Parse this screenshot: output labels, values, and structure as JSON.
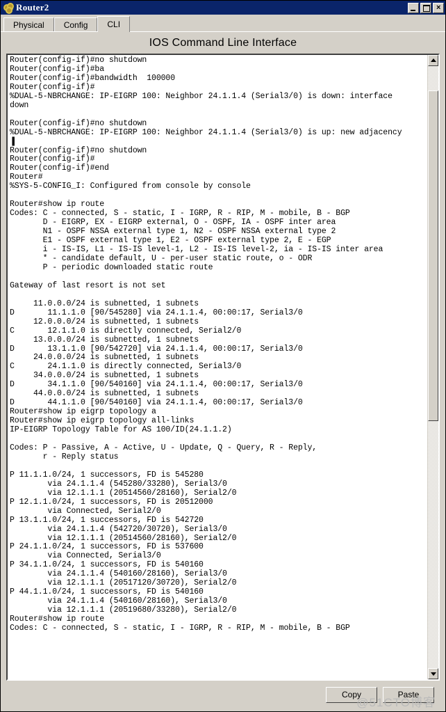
{
  "window": {
    "title": "Router2",
    "icon": "router-icon",
    "controls": {
      "minimize": "_",
      "maximize": "□",
      "close": "×"
    }
  },
  "tabs": [
    {
      "label": "Physical",
      "active": false
    },
    {
      "label": "Config",
      "active": false
    },
    {
      "label": "CLI",
      "active": true
    }
  ],
  "panel": {
    "title": "IOS Command Line Interface"
  },
  "terminal": {
    "lines": [
      "Router(config-if)#no shutdown",
      "Router(config-if)#ba",
      "Router(config-if)#bandwidth  100000",
      "Router(config-if)#",
      "%DUAL-5-NBRCHANGE: IP-EIGRP 100: Neighbor 24.1.1.4 (Serial3/0) is down: interface",
      "down",
      "",
      "Router(config-if)#no shutdown",
      "%DUAL-5-NBRCHANGE: IP-EIGRP 100: Neighbor 24.1.1.4 (Serial3/0) is up: new adjacency",
      "▐",
      "Router(config-if)#no shutdown",
      "Router(config-if)#",
      "Router(config-if)#end",
      "Router#",
      "%SYS-5-CONFIG_I: Configured from console by console",
      "",
      "Router#show ip route",
      "Codes: C - connected, S - static, I - IGRP, R - RIP, M - mobile, B - BGP",
      "       D - EIGRP, EX - EIGRP external, O - OSPF, IA - OSPF inter area",
      "       N1 - OSPF NSSA external type 1, N2 - OSPF NSSA external type 2",
      "       E1 - OSPF external type 1, E2 - OSPF external type 2, E - EGP",
      "       i - IS-IS, L1 - IS-IS level-1, L2 - IS-IS level-2, ia - IS-IS inter area",
      "       * - candidate default, U - per-user static route, o - ODR",
      "       P - periodic downloaded static route",
      "",
      "Gateway of last resort is not set",
      "",
      "     11.0.0.0/24 is subnetted, 1 subnets",
      "D       11.1.1.0 [90/545280] via 24.1.1.4, 00:00:17, Serial3/0",
      "     12.0.0.0/24 is subnetted, 1 subnets",
      "C       12.1.1.0 is directly connected, Serial2/0",
      "     13.0.0.0/24 is subnetted, 1 subnets",
      "D       13.1.1.0 [90/542720] via 24.1.1.4, 00:00:17, Serial3/0",
      "     24.0.0.0/24 is subnetted, 1 subnets",
      "C       24.1.1.0 is directly connected, Serial3/0",
      "     34.0.0.0/24 is subnetted, 1 subnets",
      "D       34.1.1.0 [90/540160] via 24.1.1.4, 00:00:17, Serial3/0",
      "     44.0.0.0/24 is subnetted, 1 subnets",
      "D       44.1.1.0 [90/540160] via 24.1.1.4, 00:00:17, Serial3/0",
      "Router#show ip eigrp topology a",
      "Router#show ip eigrp topology all-links",
      "IP-EIGRP Topology Table for AS 100/ID(24.1.1.2)",
      "",
      "Codes: P - Passive, A - Active, U - Update, Q - Query, R - Reply,",
      "       r - Reply status",
      "",
      "P 11.1.1.0/24, 1 successors, FD is 545280",
      "        via 24.1.1.4 (545280/33280), Serial3/0",
      "        via 12.1.1.1 (20514560/28160), Serial2/0",
      "P 12.1.1.0/24, 1 successors, FD is 20512000",
      "        via Connected, Serial2/0",
      "P 13.1.1.0/24, 1 successors, FD is 542720",
      "        via 24.1.1.4 (542720/30720), Serial3/0",
      "        via 12.1.1.1 (20514560/28160), Serial2/0",
      "P 24.1.1.0/24, 1 successors, FD is 537600",
      "        via Connected, Serial3/0",
      "P 34.1.1.0/24, 1 successors, FD is 540160",
      "        via 24.1.1.4 (540160/28160), Serial3/0",
      "        via 12.1.1.1 (20517120/30720), Serial2/0",
      "P 44.1.1.0/24, 1 successors, FD is 540160",
      "        via 24.1.1.4 (540160/28160), Serial3/0",
      "        via 12.1.1.1 (20519680/33280), Serial2/0",
      "Router#show ip route",
      "Codes: C - connected, S - static, I - IGRP, R - RIP, M - mobile, B - BGP"
    ]
  },
  "scrollbar": {
    "up_arrow": "scroll-up-icon",
    "down_arrow": "scroll-down-icon",
    "thumb_top_pct": 4,
    "thumb_height_pct": 55
  },
  "footer": {
    "copy_label": "Copy",
    "paste_label": "Paste",
    "watermark": "@51CTO博客"
  },
  "colors": {
    "titlebar": "#0a246a",
    "chrome": "#d4d0c8",
    "terminal_bg": "#ffffff",
    "terminal_fg": "#000000"
  }
}
